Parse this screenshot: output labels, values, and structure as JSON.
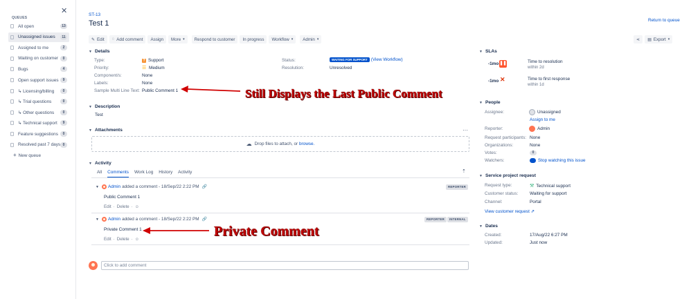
{
  "sidebar": {
    "heading": "QUEUES",
    "items": [
      {
        "label": "All open",
        "count": "13"
      },
      {
        "label": "Unassigned issues",
        "count": "11"
      },
      {
        "label": "Assigned to me",
        "count": "2"
      },
      {
        "label": "Waiting on customer",
        "count": "0"
      },
      {
        "label": "Bugs",
        "count": "4"
      },
      {
        "label": "Open support issues",
        "count": "9"
      },
      {
        "label": "↳ Licensing/billing",
        "count": "0"
      },
      {
        "label": "↳ Trial questions",
        "count": "0"
      },
      {
        "label": "↳ Other questions",
        "count": "0"
      },
      {
        "label": "↳ Technical support",
        "count": "9"
      },
      {
        "label": "Feature suggestions",
        "count": "0"
      },
      {
        "label": "Resolved past 7 days",
        "count": "0"
      }
    ],
    "active_index": 1,
    "new_queue": "New queue"
  },
  "header": {
    "breadcrumb": "ST-13",
    "title": "Test 1",
    "return_link": "Return to queue"
  },
  "toolbar": {
    "edit": "Edit",
    "add_comment": "Add comment",
    "assign": "Assign",
    "more": "More",
    "respond": "Respond to customer",
    "in_progress": "In progress",
    "workflow": "Workflow",
    "admin": "Admin",
    "export": "Export"
  },
  "details": {
    "heading": "Details",
    "type_label": "Type:",
    "type_value": "Support",
    "priority_label": "Priority:",
    "priority_value": "Medium",
    "components_label": "Component/s:",
    "components_value": "None",
    "labels_label": "Labels:",
    "labels_value": "None",
    "multiline_label": "Sample Multi Line Text:",
    "multiline_value": "Public Comment 1",
    "status_label": "Status:",
    "status_value": "WAITING FOR SUPPORT",
    "view_workflow": "(View Workflow)",
    "resolution_label": "Resolution:",
    "resolution_value": "Unresolved"
  },
  "description": {
    "heading": "Description",
    "text": "Test"
  },
  "attachments": {
    "heading": "Attachments",
    "drop_text": "Drop files to attach, or",
    "browse": "browse."
  },
  "activity": {
    "heading": "Activity",
    "tabs": [
      "All",
      "Comments",
      "Work Log",
      "History",
      "Activity"
    ],
    "active_tab": 1,
    "comments": [
      {
        "author": "Admin",
        "meta": "added a comment - 18/Sep/22 2:22 PM",
        "body": "Public Comment 1",
        "tags": [
          "REPORTER"
        ],
        "edit": "Edit",
        "delete": "Delete"
      },
      {
        "author": "Admin",
        "meta": "added a comment - 18/Sep/22 2:22 PM",
        "body": "Private Comment 1",
        "tags": [
          "REPORTER",
          "INTERNAL"
        ],
        "edit": "Edit",
        "delete": "Delete"
      }
    ],
    "add_placeholder": "Click to add comment"
  },
  "slas": {
    "heading": "SLAs",
    "items": [
      {
        "time": "-1mo",
        "name": "Time to resolution",
        "sub": "within 2d",
        "state": "paused"
      },
      {
        "time": "-1mo",
        "name": "Time to first response",
        "sub": "within 1d",
        "state": "breached"
      }
    ]
  },
  "people": {
    "heading": "People",
    "assignee_label": "Assignee:",
    "assignee_value": "Unassigned",
    "assign_to_me": "Assign to me",
    "reporter_label": "Reporter:",
    "reporter_value": "Admin",
    "participants_label": "Request participants:",
    "participants_value": "None",
    "orgs_label": "Organizations:",
    "orgs_value": "None",
    "votes_label": "Votes:",
    "votes_value": "0",
    "watchers_label": "Watchers:",
    "watchers_value": "Stop watching this issue"
  },
  "service": {
    "heading": "Service project request",
    "request_type_label": "Request type:",
    "request_type_value": "Technical support",
    "customer_status_label": "Customer status:",
    "customer_status_value": "Waiting for support",
    "channel_label": "Channel:",
    "channel_value": "Portal",
    "view_request": "View customer request"
  },
  "dates": {
    "heading": "Dates",
    "created_label": "Created:",
    "created_value": "17/Aug/22 6:27 PM",
    "updated_label": "Updated:",
    "updated_value": "Just now"
  },
  "annotations": {
    "top": "Still Displays the Last Public Comment",
    "bottom": "Private Comment"
  },
  "colors": {
    "accent": "#0052cc",
    "annotation": "#c00000"
  }
}
